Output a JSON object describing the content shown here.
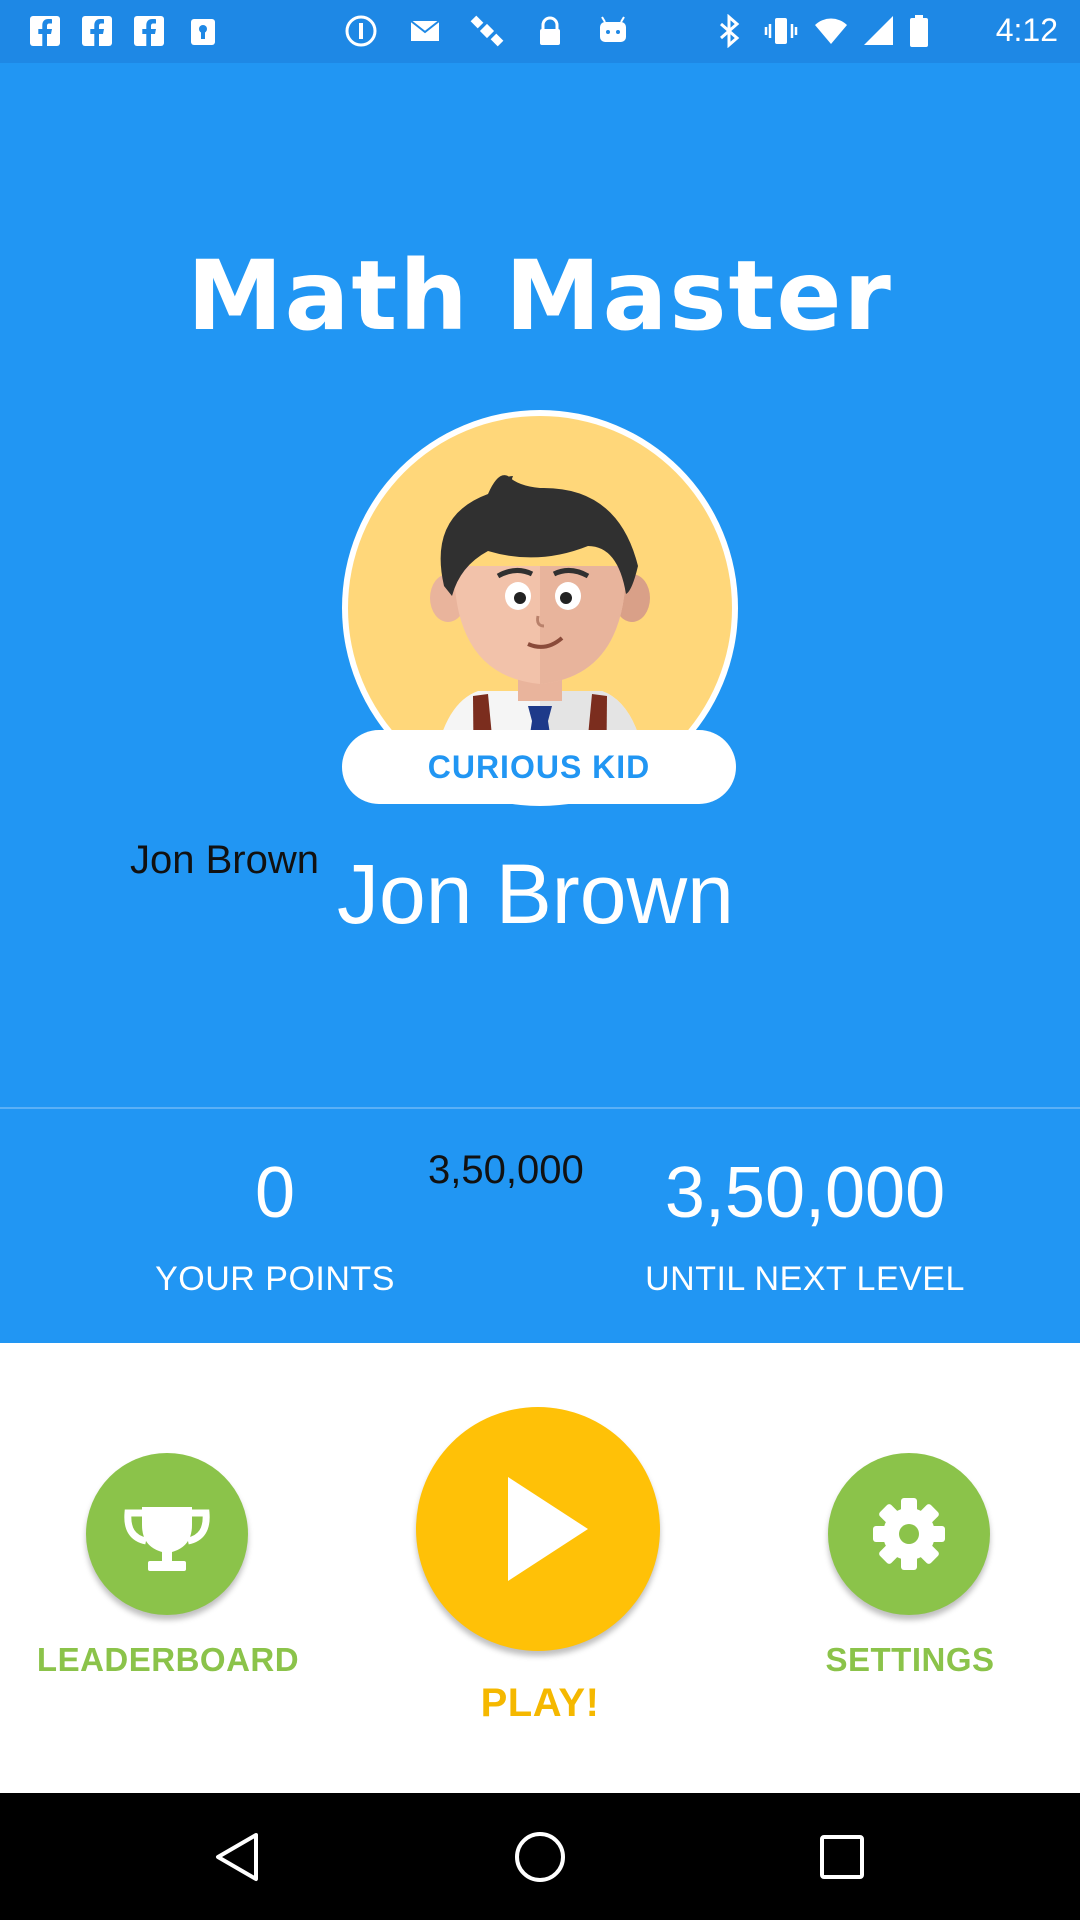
{
  "status_bar": {
    "time": "4:12",
    "icons": [
      "facebook-icon",
      "facebook-icon",
      "facebook-icon",
      "lock-icon",
      "info-icon",
      "mail-icon",
      "satellite-icon",
      "lock-icon",
      "android-icon",
      "bluetooth-icon",
      "vibrate-icon",
      "wifi-icon",
      "signal-icon",
      "battery-icon"
    ]
  },
  "app": {
    "title": "Math Master",
    "avatar_icon": "boy-avatar-icon",
    "rank": "CURIOUS KID",
    "name_small": "Jon Brown",
    "name_large": "Jon Brown"
  },
  "stats": {
    "points_value": "0",
    "points_label": "YOUR POINTS",
    "next_small": "3,50,000",
    "next_value": "3,50,000",
    "next_label": "UNTIL NEXT LEVEL"
  },
  "actions": {
    "leaderboard_label": "LEADERBOARD",
    "play_label": "PLAY!",
    "settings_label": "SETTINGS"
  },
  "colors": {
    "primary": "#2196F3",
    "green": "#8BC34A",
    "yellow": "#FFC107",
    "yellow_text": "#F5B800"
  }
}
